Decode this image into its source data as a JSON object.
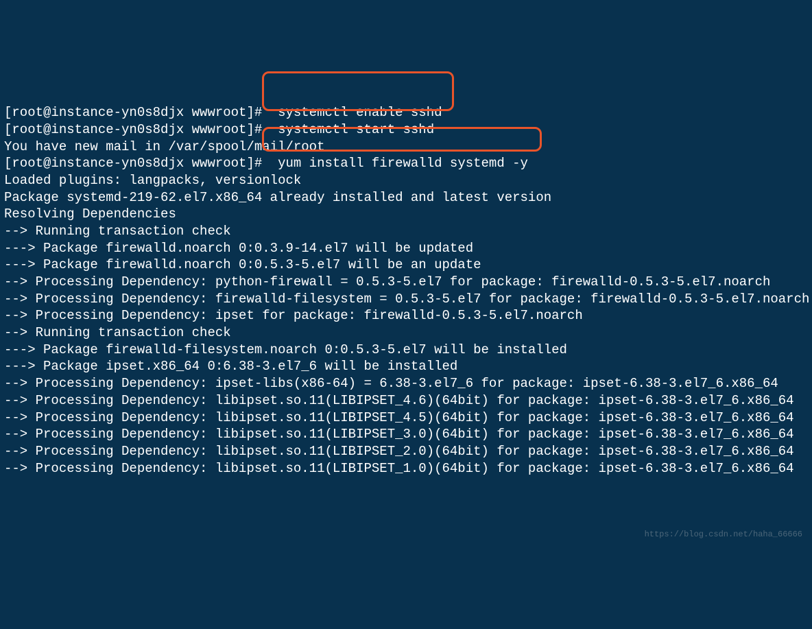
{
  "lines": [
    {
      "p": "[root@instance-yn0s8djx wwwroot]# ",
      "c": " systemctl enable sshd"
    },
    {
      "p": "[root@instance-yn0s8djx wwwroot]# ",
      "c": " systemctl start sshd"
    },
    {
      "p": "",
      "c": "You have new mail in /var/spool/mail/root"
    },
    {
      "p": "[root@instance-yn0s8djx wwwroot]# ",
      "c": " yum install firewalld systemd -y"
    },
    {
      "p": "",
      "c": "Loaded plugins: langpacks, versionlock"
    },
    {
      "p": "",
      "c": "Package systemd-219-62.el7.x86_64 already installed and latest version"
    },
    {
      "p": "",
      "c": "Resolving Dependencies"
    },
    {
      "p": "",
      "c": "--> Running transaction check"
    },
    {
      "p": "",
      "c": "---> Package firewalld.noarch 0:0.3.9-14.el7 will be updated"
    },
    {
      "p": "",
      "c": "---> Package firewalld.noarch 0:0.5.3-5.el7 will be an update"
    },
    {
      "p": "",
      "c": "--> Processing Dependency: python-firewall = 0.5.3-5.el7 for package: firewalld-0.5.3-5.el7.noarch"
    },
    {
      "p": "",
      "c": "--> Processing Dependency: firewalld-filesystem = 0.5.3-5.el7 for package: firewalld-0.5.3-5.el7.noarch"
    },
    {
      "p": "",
      "c": "--> Processing Dependency: ipset for package: firewalld-0.5.3-5.el7.noarch"
    },
    {
      "p": "",
      "c": "--> Running transaction check"
    },
    {
      "p": "",
      "c": "---> Package firewalld-filesystem.noarch 0:0.5.3-5.el7 will be installed"
    },
    {
      "p": "",
      "c": "---> Package ipset.x86_64 0:6.38-3.el7_6 will be installed"
    },
    {
      "p": "",
      "c": "--> Processing Dependency: ipset-libs(x86-64) = 6.38-3.el7_6 for package: ipset-6.38-3.el7_6.x86_64"
    },
    {
      "p": "",
      "c": "--> Processing Dependency: libipset.so.11(LIBIPSET_4.6)(64bit) for package: ipset-6.38-3.el7_6.x86_64"
    },
    {
      "p": "",
      "c": "--> Processing Dependency: libipset.so.11(LIBIPSET_4.5)(64bit) for package: ipset-6.38-3.el7_6.x86_64"
    },
    {
      "p": "",
      "c": "--> Processing Dependency: libipset.so.11(LIBIPSET_3.0)(64bit) for package: ipset-6.38-3.el7_6.x86_64"
    },
    {
      "p": "",
      "c": "--> Processing Dependency: libipset.so.11(LIBIPSET_2.0)(64bit) for package: ipset-6.38-3.el7_6.x86_64"
    },
    {
      "p": "",
      "c": "--> Processing Dependency: libipset.so.11(LIBIPSET_1.0)(64bit) for package: ipset-6.38-3.el7_6.x86_64"
    }
  ],
  "watermark": "https://blog.csdn.net/haha_66666"
}
